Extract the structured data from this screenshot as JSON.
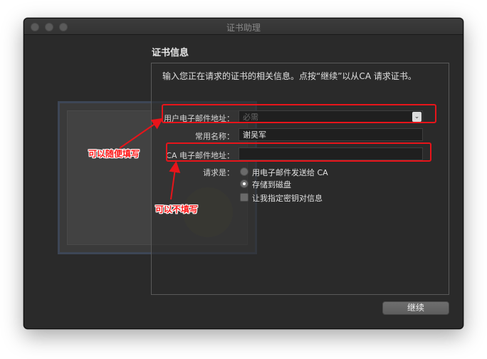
{
  "window": {
    "title": "证书助理"
  },
  "section": {
    "title": "证书信息"
  },
  "intro": "输入您正在请求的证书的相关信息。点按“继续”以从CA 请求证书。",
  "form": {
    "email_label": "用户电子邮件地址：",
    "email_placeholder": "必需",
    "common_name_label": "常用名称：",
    "common_name_value": "谢吴军",
    "ca_email_label": "CA 电子邮件地址：",
    "ca_email_value": "",
    "request_label": "请求是：",
    "options": [
      {
        "label": "用电子邮件发送给 CA",
        "selected": false
      },
      {
        "label": "存储到磁盘",
        "selected": true
      }
    ],
    "key_pair_label": "让我指定密钥对信息",
    "key_pair_checked": false
  },
  "buttons": {
    "continue": "继续"
  },
  "annotations": {
    "note1": "可以随便填写",
    "note2": "可以不填写",
    "color": "#e8141a"
  },
  "icons": {
    "dropdown": "chevron-down-icon"
  }
}
